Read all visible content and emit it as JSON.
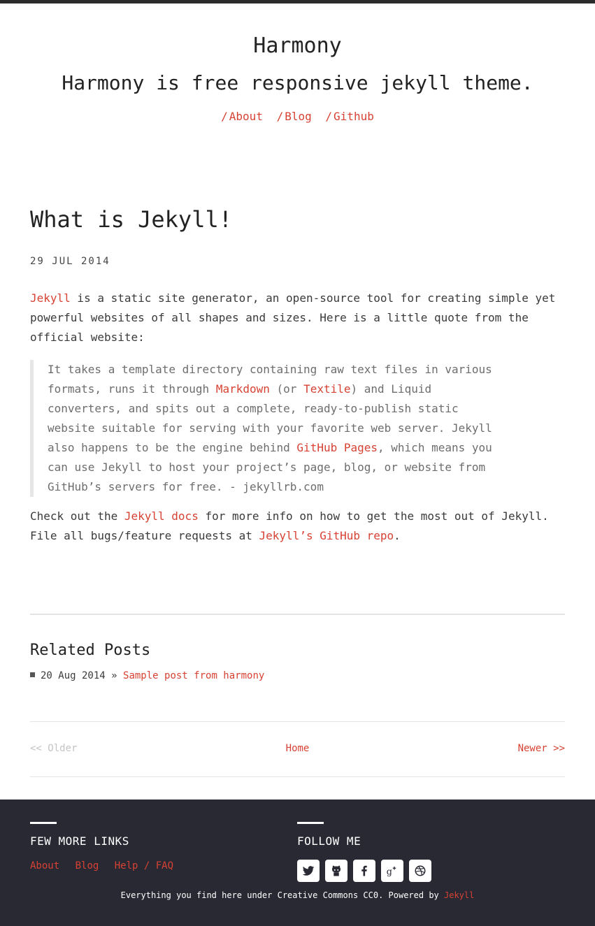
{
  "site": {
    "title": "Harmony",
    "tagline": "Harmony is free responsive jekyll theme.",
    "nav": [
      {
        "slash": "/",
        "label": "About"
      },
      {
        "slash": "/",
        "label": "Blog"
      },
      {
        "slash": "/",
        "label": "Github"
      }
    ]
  },
  "post": {
    "title": "What is Jekyll!",
    "date": "29 JUL 2014",
    "intro": {
      "link": "Jekyll",
      "text": " is a static site generator, an open-source tool for creating simple yet powerful websites of all shapes and sizes. Here is a little quote from the official website:"
    },
    "quote": {
      "t1": "It takes a template directory containing raw text files in various formats, runs it through ",
      "link1": "Markdown",
      "t2": " (or ",
      "link2": "Textile",
      "t3": ") and Liquid converters, and spits out a complete, ready-to-publish static website suitable for serving with your favorite web server. Jekyll also happens to be the engine behind ",
      "link3": "GitHub Pages",
      "t4": ", which means you can use Jekyll to host your project’s page, blog, or website from GitHub’s servers for free. - jekyllrb.com"
    },
    "outro": {
      "t1": "Check out the ",
      "link1": "Jekyll docs",
      "t2": " for more info on how to get the most out of Jekyll. File all bugs/feature requests at ",
      "link2": "Jekyll’s GitHub repo",
      "t3": "."
    }
  },
  "related": {
    "title": "Related Posts",
    "items": [
      {
        "date": "20 Aug 2014",
        "sep": " » ",
        "label": "Sample post from harmony"
      }
    ]
  },
  "pager": {
    "older": "<< Older",
    "home": "Home",
    "newer": "Newer >>"
  },
  "footer": {
    "links_title": "FEW MORE LINKS",
    "links": [
      "About",
      "Blog",
      "Help / FAQ"
    ],
    "follow_title": "FOLLOW ME",
    "social": [
      "twitter-icon",
      "github-icon",
      "facebook-icon",
      "google-plus-icon",
      "dribbble-icon"
    ],
    "copyright_text": "Everything you find here under Creative Commons CC0. Powered by ",
    "copyright_link": "Jekyll"
  },
  "colors": {
    "accent": "#d74234",
    "footer_bg": "#282933",
    "muted": "#c4c4c4"
  }
}
